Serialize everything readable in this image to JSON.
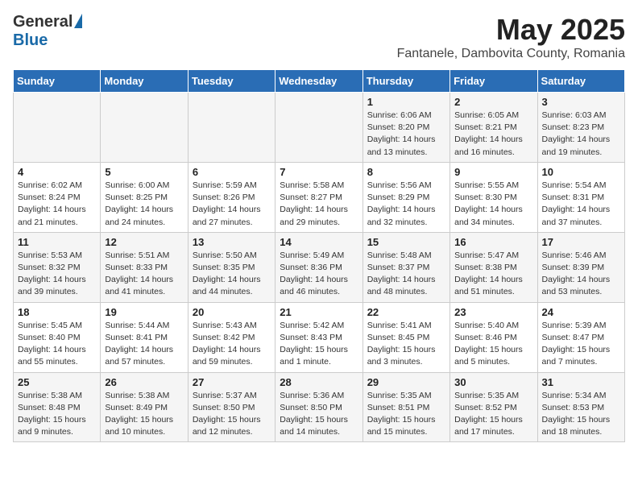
{
  "header": {
    "logo_general": "General",
    "logo_blue": "Blue",
    "title": "May 2025",
    "subtitle": "Fantanele, Dambovita County, Romania"
  },
  "days_of_week": [
    "Sunday",
    "Monday",
    "Tuesday",
    "Wednesday",
    "Thursday",
    "Friday",
    "Saturday"
  ],
  "weeks": [
    [
      {
        "num": "",
        "info": ""
      },
      {
        "num": "",
        "info": ""
      },
      {
        "num": "",
        "info": ""
      },
      {
        "num": "",
        "info": ""
      },
      {
        "num": "1",
        "info": "Sunrise: 6:06 AM\nSunset: 8:20 PM\nDaylight: 14 hours\nand 13 minutes."
      },
      {
        "num": "2",
        "info": "Sunrise: 6:05 AM\nSunset: 8:21 PM\nDaylight: 14 hours\nand 16 minutes."
      },
      {
        "num": "3",
        "info": "Sunrise: 6:03 AM\nSunset: 8:23 PM\nDaylight: 14 hours\nand 19 minutes."
      }
    ],
    [
      {
        "num": "4",
        "info": "Sunrise: 6:02 AM\nSunset: 8:24 PM\nDaylight: 14 hours\nand 21 minutes."
      },
      {
        "num": "5",
        "info": "Sunrise: 6:00 AM\nSunset: 8:25 PM\nDaylight: 14 hours\nand 24 minutes."
      },
      {
        "num": "6",
        "info": "Sunrise: 5:59 AM\nSunset: 8:26 PM\nDaylight: 14 hours\nand 27 minutes."
      },
      {
        "num": "7",
        "info": "Sunrise: 5:58 AM\nSunset: 8:27 PM\nDaylight: 14 hours\nand 29 minutes."
      },
      {
        "num": "8",
        "info": "Sunrise: 5:56 AM\nSunset: 8:29 PM\nDaylight: 14 hours\nand 32 minutes."
      },
      {
        "num": "9",
        "info": "Sunrise: 5:55 AM\nSunset: 8:30 PM\nDaylight: 14 hours\nand 34 minutes."
      },
      {
        "num": "10",
        "info": "Sunrise: 5:54 AM\nSunset: 8:31 PM\nDaylight: 14 hours\nand 37 minutes."
      }
    ],
    [
      {
        "num": "11",
        "info": "Sunrise: 5:53 AM\nSunset: 8:32 PM\nDaylight: 14 hours\nand 39 minutes."
      },
      {
        "num": "12",
        "info": "Sunrise: 5:51 AM\nSunset: 8:33 PM\nDaylight: 14 hours\nand 41 minutes."
      },
      {
        "num": "13",
        "info": "Sunrise: 5:50 AM\nSunset: 8:35 PM\nDaylight: 14 hours\nand 44 minutes."
      },
      {
        "num": "14",
        "info": "Sunrise: 5:49 AM\nSunset: 8:36 PM\nDaylight: 14 hours\nand 46 minutes."
      },
      {
        "num": "15",
        "info": "Sunrise: 5:48 AM\nSunset: 8:37 PM\nDaylight: 14 hours\nand 48 minutes."
      },
      {
        "num": "16",
        "info": "Sunrise: 5:47 AM\nSunset: 8:38 PM\nDaylight: 14 hours\nand 51 minutes."
      },
      {
        "num": "17",
        "info": "Sunrise: 5:46 AM\nSunset: 8:39 PM\nDaylight: 14 hours\nand 53 minutes."
      }
    ],
    [
      {
        "num": "18",
        "info": "Sunrise: 5:45 AM\nSunset: 8:40 PM\nDaylight: 14 hours\nand 55 minutes."
      },
      {
        "num": "19",
        "info": "Sunrise: 5:44 AM\nSunset: 8:41 PM\nDaylight: 14 hours\nand 57 minutes."
      },
      {
        "num": "20",
        "info": "Sunrise: 5:43 AM\nSunset: 8:42 PM\nDaylight: 14 hours\nand 59 minutes."
      },
      {
        "num": "21",
        "info": "Sunrise: 5:42 AM\nSunset: 8:43 PM\nDaylight: 15 hours\nand 1 minute."
      },
      {
        "num": "22",
        "info": "Sunrise: 5:41 AM\nSunset: 8:45 PM\nDaylight: 15 hours\nand 3 minutes."
      },
      {
        "num": "23",
        "info": "Sunrise: 5:40 AM\nSunset: 8:46 PM\nDaylight: 15 hours\nand 5 minutes."
      },
      {
        "num": "24",
        "info": "Sunrise: 5:39 AM\nSunset: 8:47 PM\nDaylight: 15 hours\nand 7 minutes."
      }
    ],
    [
      {
        "num": "25",
        "info": "Sunrise: 5:38 AM\nSunset: 8:48 PM\nDaylight: 15 hours\nand 9 minutes."
      },
      {
        "num": "26",
        "info": "Sunrise: 5:38 AM\nSunset: 8:49 PM\nDaylight: 15 hours\nand 10 minutes."
      },
      {
        "num": "27",
        "info": "Sunrise: 5:37 AM\nSunset: 8:50 PM\nDaylight: 15 hours\nand 12 minutes."
      },
      {
        "num": "28",
        "info": "Sunrise: 5:36 AM\nSunset: 8:50 PM\nDaylight: 15 hours\nand 14 minutes."
      },
      {
        "num": "29",
        "info": "Sunrise: 5:35 AM\nSunset: 8:51 PM\nDaylight: 15 hours\nand 15 minutes."
      },
      {
        "num": "30",
        "info": "Sunrise: 5:35 AM\nSunset: 8:52 PM\nDaylight: 15 hours\nand 17 minutes."
      },
      {
        "num": "31",
        "info": "Sunrise: 5:34 AM\nSunset: 8:53 PM\nDaylight: 15 hours\nand 18 minutes."
      }
    ]
  ]
}
